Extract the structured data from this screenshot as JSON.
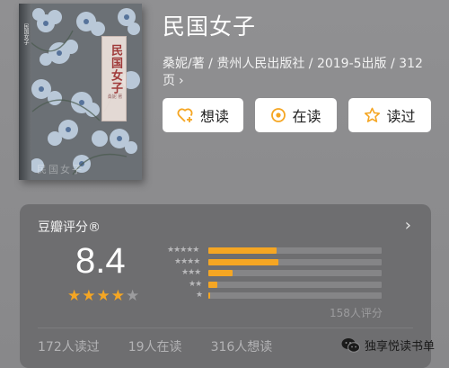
{
  "book": {
    "cover": {
      "spine_text": "民国女子",
      "title": "民国女子",
      "panel_sub": "桑妮 著",
      "bottom_text": "民国女子"
    },
    "title": "民国女子",
    "meta": "桑妮/著 / 贵州人民出版社 / 2019-5出版 / 312页"
  },
  "actions": {
    "want": "想读",
    "reading": "在读",
    "read": "读过"
  },
  "rating": {
    "title": "豆瓣评分®",
    "score": "8.4",
    "stars_filled": 4,
    "stars_total": 5,
    "distribution": [
      {
        "stars": "★★★★★",
        "percent": 0.4
      },
      {
        "stars": "★★★★",
        "percent": 0.41
      },
      {
        "stars": "★★★",
        "percent": 0.14
      },
      {
        "stars": "★★",
        "percent": 0.05
      },
      {
        "stars": "★",
        "percent": 0.01
      }
    ],
    "count_text": "158人评分"
  },
  "stats": {
    "read": "172人读过",
    "reading": "19人在读",
    "want": "316人想读"
  },
  "watermark": {
    "text": "独享悦读书单"
  },
  "colors": {
    "accent": "#f5a623",
    "background": "#8a8a8c",
    "card": "#6e6e70"
  }
}
